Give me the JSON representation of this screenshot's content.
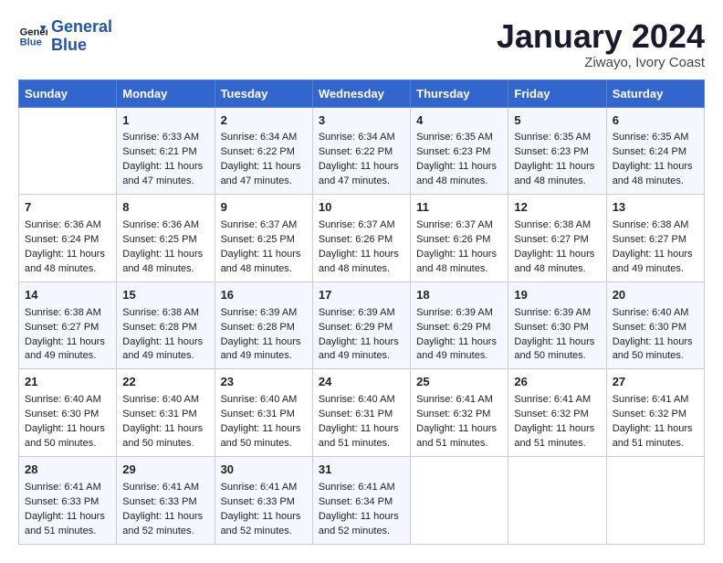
{
  "header": {
    "logo_line1": "General",
    "logo_line2": "Blue",
    "month_title": "January 2024",
    "subtitle": "Ziwayo, Ivory Coast"
  },
  "columns": [
    "Sunday",
    "Monday",
    "Tuesday",
    "Wednesday",
    "Thursday",
    "Friday",
    "Saturday"
  ],
  "rows": [
    [
      {
        "day": "",
        "info": ""
      },
      {
        "day": "1",
        "info": "Sunrise: 6:33 AM\nSunset: 6:21 PM\nDaylight: 11 hours\nand 47 minutes."
      },
      {
        "day": "2",
        "info": "Sunrise: 6:34 AM\nSunset: 6:22 PM\nDaylight: 11 hours\nand 47 minutes."
      },
      {
        "day": "3",
        "info": "Sunrise: 6:34 AM\nSunset: 6:22 PM\nDaylight: 11 hours\nand 47 minutes."
      },
      {
        "day": "4",
        "info": "Sunrise: 6:35 AM\nSunset: 6:23 PM\nDaylight: 11 hours\nand 48 minutes."
      },
      {
        "day": "5",
        "info": "Sunrise: 6:35 AM\nSunset: 6:23 PM\nDaylight: 11 hours\nand 48 minutes."
      },
      {
        "day": "6",
        "info": "Sunrise: 6:35 AM\nSunset: 6:24 PM\nDaylight: 11 hours\nand 48 minutes."
      }
    ],
    [
      {
        "day": "7",
        "info": "Sunrise: 6:36 AM\nSunset: 6:24 PM\nDaylight: 11 hours\nand 48 minutes."
      },
      {
        "day": "8",
        "info": "Sunrise: 6:36 AM\nSunset: 6:25 PM\nDaylight: 11 hours\nand 48 minutes."
      },
      {
        "day": "9",
        "info": "Sunrise: 6:37 AM\nSunset: 6:25 PM\nDaylight: 11 hours\nand 48 minutes."
      },
      {
        "day": "10",
        "info": "Sunrise: 6:37 AM\nSunset: 6:26 PM\nDaylight: 11 hours\nand 48 minutes."
      },
      {
        "day": "11",
        "info": "Sunrise: 6:37 AM\nSunset: 6:26 PM\nDaylight: 11 hours\nand 48 minutes."
      },
      {
        "day": "12",
        "info": "Sunrise: 6:38 AM\nSunset: 6:27 PM\nDaylight: 11 hours\nand 48 minutes."
      },
      {
        "day": "13",
        "info": "Sunrise: 6:38 AM\nSunset: 6:27 PM\nDaylight: 11 hours\nand 49 minutes."
      }
    ],
    [
      {
        "day": "14",
        "info": "Sunrise: 6:38 AM\nSunset: 6:27 PM\nDaylight: 11 hours\nand 49 minutes."
      },
      {
        "day": "15",
        "info": "Sunrise: 6:38 AM\nSunset: 6:28 PM\nDaylight: 11 hours\nand 49 minutes."
      },
      {
        "day": "16",
        "info": "Sunrise: 6:39 AM\nSunset: 6:28 PM\nDaylight: 11 hours\nand 49 minutes."
      },
      {
        "day": "17",
        "info": "Sunrise: 6:39 AM\nSunset: 6:29 PM\nDaylight: 11 hours\nand 49 minutes."
      },
      {
        "day": "18",
        "info": "Sunrise: 6:39 AM\nSunset: 6:29 PM\nDaylight: 11 hours\nand 49 minutes."
      },
      {
        "day": "19",
        "info": "Sunrise: 6:39 AM\nSunset: 6:30 PM\nDaylight: 11 hours\nand 50 minutes."
      },
      {
        "day": "20",
        "info": "Sunrise: 6:40 AM\nSunset: 6:30 PM\nDaylight: 11 hours\nand 50 minutes."
      }
    ],
    [
      {
        "day": "21",
        "info": "Sunrise: 6:40 AM\nSunset: 6:30 PM\nDaylight: 11 hours\nand 50 minutes."
      },
      {
        "day": "22",
        "info": "Sunrise: 6:40 AM\nSunset: 6:31 PM\nDaylight: 11 hours\nand 50 minutes."
      },
      {
        "day": "23",
        "info": "Sunrise: 6:40 AM\nSunset: 6:31 PM\nDaylight: 11 hours\nand 50 minutes."
      },
      {
        "day": "24",
        "info": "Sunrise: 6:40 AM\nSunset: 6:31 PM\nDaylight: 11 hours\nand 51 minutes."
      },
      {
        "day": "25",
        "info": "Sunrise: 6:41 AM\nSunset: 6:32 PM\nDaylight: 11 hours\nand 51 minutes."
      },
      {
        "day": "26",
        "info": "Sunrise: 6:41 AM\nSunset: 6:32 PM\nDaylight: 11 hours\nand 51 minutes."
      },
      {
        "day": "27",
        "info": "Sunrise: 6:41 AM\nSunset: 6:32 PM\nDaylight: 11 hours\nand 51 minutes."
      }
    ],
    [
      {
        "day": "28",
        "info": "Sunrise: 6:41 AM\nSunset: 6:33 PM\nDaylight: 11 hours\nand 51 minutes."
      },
      {
        "day": "29",
        "info": "Sunrise: 6:41 AM\nSunset: 6:33 PM\nDaylight: 11 hours\nand 52 minutes."
      },
      {
        "day": "30",
        "info": "Sunrise: 6:41 AM\nSunset: 6:33 PM\nDaylight: 11 hours\nand 52 minutes."
      },
      {
        "day": "31",
        "info": "Sunrise: 6:41 AM\nSunset: 6:34 PM\nDaylight: 11 hours\nand 52 minutes."
      },
      {
        "day": "",
        "info": ""
      },
      {
        "day": "",
        "info": ""
      },
      {
        "day": "",
        "info": ""
      }
    ]
  ]
}
